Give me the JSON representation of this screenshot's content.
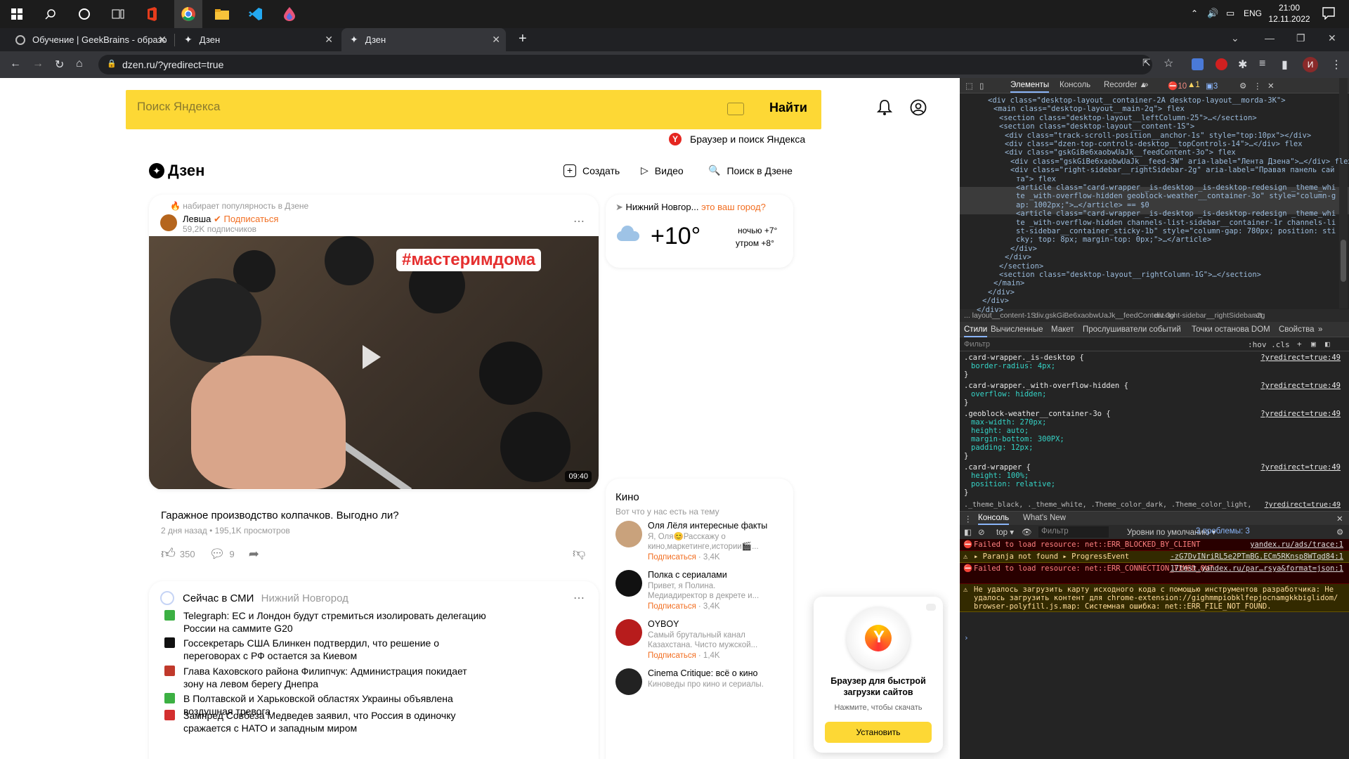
{
  "taskbar": {
    "time": "21:00",
    "date": "12.11.2022",
    "lang": "ENG"
  },
  "tabs": [
    {
      "title": "Обучение | GeekBrains - образо"
    },
    {
      "title": "Дзен"
    },
    {
      "title": "Дзен"
    }
  ],
  "url": "dzen.ru/?yredirect=true",
  "search": {
    "placeholder": "Поиск Яндекса",
    "button": "Найти",
    "promo": "Браузер и поиск Яндекса"
  },
  "dzen": {
    "logo": "Дзен",
    "create": "Создать",
    "video": "Видео",
    "search": "Поиск в Дзене"
  },
  "post": {
    "trending": "набирает популярность в Дзене",
    "author": "Левша",
    "subscribe": "Подписаться",
    "subscribers": "59,2K подписчиков",
    "overlay_tag": "#мастеримдома",
    "duration": "09:40",
    "title": "Гаражное производство колпачков. Выгодно ли?",
    "meta": "2 дня назад • 195,1K просмотров",
    "likes": "350",
    "comments": "9"
  },
  "weather": {
    "city": "Нижний Новгор...",
    "question": "это ваш город?",
    "temp": "+10°",
    "night": "ночью +7°",
    "morning": "утром +8°"
  },
  "news": {
    "title": "Сейчас в СМИ",
    "region": "Нижний Новгород",
    "items": [
      {
        "text": "Telegraph: ЕС и Лондон будут стремиться изолировать делегацию России на саммите G20",
        "color": "#3cb043"
      },
      {
        "text": "Госсекретарь США Блинкен подтвердил, что решение о переговорах с РФ остается за Киевом",
        "color": "#111111"
      },
      {
        "text": "Глава Каховского района Филипчук: Администрация покидает зону на левом берегу Днепра",
        "color": "#c0392b"
      },
      {
        "text": "В Полтавской и Харьковской областях Украины объявлена воздушная тревога",
        "color": "#3cb043"
      },
      {
        "text": "Зампред Совбеза Медведев заявил, что Россия в одиночку сражается с НАТО и западным миром",
        "color": "#d32f2f"
      }
    ]
  },
  "channels": {
    "title": "Кино",
    "subtitle": "Вот что у нас есть на тему",
    "items": [
      {
        "name": "Оля Лёля интересные факты",
        "desc": "Я, Оля😊Расскажу о кино,маркетинге,истории🎬...",
        "subscribe": "Подписаться",
        "count": "· 3,4K",
        "color": "#c9a27c"
      },
      {
        "name": "Полка с сериалами",
        "desc": "Привет, я Полина. Медиадиректор в декрете и...",
        "subscribe": "Подписаться",
        "count": "· 3,4K",
        "color": "#111111"
      },
      {
        "name": "OYBOY",
        "desc": "Самый брутальный канал Казахстана. Чисто мужской...",
        "subscribe": "Подписаться",
        "count": "· 1,4K",
        "color": "#b71c1c"
      },
      {
        "name": "Cinema Critique: всё о кино",
        "desc": "Киноведы про кино и сериалы.",
        "subscribe": "",
        "count": "",
        "color": "#222222"
      }
    ]
  },
  "promo": {
    "title": "Браузер для быстрой загрузки сайтов",
    "subtitle": "Нажмите, чтобы скачать",
    "button": "Установить"
  },
  "devtools": {
    "tabs": [
      "Элементы",
      "Консоль",
      "Recorder ▲"
    ],
    "errors": "10",
    "warnings": "1",
    "messages": "3",
    "dom": [
      "<div class=\"desktop-layout__container-2A desktop-layout__morda-3K\">",
      "<main class=\"desktop-layout__main-2q\"> flex",
      "<section class=\"desktop-layout__leftColumn-25\">…</section>",
      "<section class=\"desktop-layout__content-1S\">",
      "<div class=\"track-scroll-position__anchor-1s\" style=\"top:10px\"></div>",
      "<div class=\"dzen-top-controls-desktop__topControls-14\">…</div> flex",
      "<div class=\"gskGiBe6xaobwUaJk__feedContent-3o\"> flex",
      "<div class=\"gskGiBe6xaobwUaJk__feed-3W\" aria-label=\"Лента Дзена\">…</div> flex",
      "<div class=\"right-sidebar__rightSidebar-2g\" aria-label=\"Правая панель сай",
      "та\"> flex",
      "<article class=\"card-wrapper _is-desktop _is-desktop-redesign _theme_whi",
      "te _with-overflow-hidden geoblock-weather__container-3o\" style=\"column-g",
      "ap: 1002px;\">…</article> == $0",
      "<article class=\"card-wrapper _is-desktop _is-desktop-redesign _theme_whi",
      "te _with-overflow-hidden channels-list-sidebar__container-1r channels-li",
      "st-sidebar__container_sticky-1b\" style=\"column-gap: 780px; position: sti",
      "cky; top: 8px; margin-top: 0px;\">…</article>",
      "</div>",
      "</div>",
      "</section>",
      "<section class=\"desktop-layout__rightColumn-1G\">…</section>",
      "</main>",
      "</div>",
      "</div>",
      "</div>"
    ],
    "breadcrumbs": [
      "... layout__content-1S",
      "div.gskGiBe6xaobwUaJk__feedContent-3o",
      "div.right-sidebar__rightSidebar-2g",
      "art"
    ],
    "style_tabs": [
      "Стили",
      "Вычисленные",
      "Макет",
      "Прослушиватели событий",
      "Точки останова DOM",
      "Свойства",
      "»"
    ],
    "filter": "Фильтр",
    "hov": ":hov .cls",
    "css_rules": [
      {
        "selector": ".card-wrapper._is-desktop {",
        "link": "?yredirect=true:49",
        "props": [
          "border-radius: 4px;"
        ]
      },
      {
        "selector": ".card-wrapper._with-overflow-hidden {",
        "link": "?yredirect=true:49",
        "props": [
          "overflow: hidden;"
        ]
      },
      {
        "selector": ".geoblock-weather__container-3o {",
        "link": "?yredirect=true:49",
        "props": [
          "max-width: 270px;",
          "height: auto;",
          "margin-bottom: 300PX;",
          "padding: 12px;"
        ]
      },
      {
        "selector": ".card-wrapper {",
        "link": "?yredirect=true:49",
        "props": [
          "height: 100%;",
          "position: relative;"
        ]
      }
    ],
    "last_rule": "._theme_black, ._theme_white, .Theme_color_dark, .Theme_color_light,",
    "last_link": "?yredirect=true:49",
    "console_tabs": [
      "Консоль",
      "What's New"
    ],
    "console_context": "top",
    "console_filter": "Фильтр",
    "console_levels": "Уровни по умолчанию",
    "console_problems": "3 проблемы: 3",
    "console": [
      {
        "type": "err",
        "text": "Failed to load resource: net::ERR_BLOCKED_BY_CLIENT",
        "link": "yandex.ru/ads/trace:1"
      },
      {
        "type": "warn",
        "text": "▸ Paranja not found ▸ ProgressEvent",
        "link": "-zG7DvINriRL5e2PTmBG.ECm5RKnsp8WTqd84:1"
      },
      {
        "type": "err",
        "text": "Failed to load resource: net::ERR_CONNECTION_TIMED_OUT",
        "link": "17test.yandex.ru/par…rsya&format=json:1"
      },
      {
        "type": "warn",
        "text": "Не удалось загрузить карту исходного кода с помощью инструментов разработчика: Не удалось загрузить контент для chrome-extension://gighmmpiobklfepjocnamgkkbiglidom/ browser-polyfill.js.map: Системная ошибка: net::ERR_FILE_NOT_FOUND.",
        "link": ""
      }
    ]
  }
}
